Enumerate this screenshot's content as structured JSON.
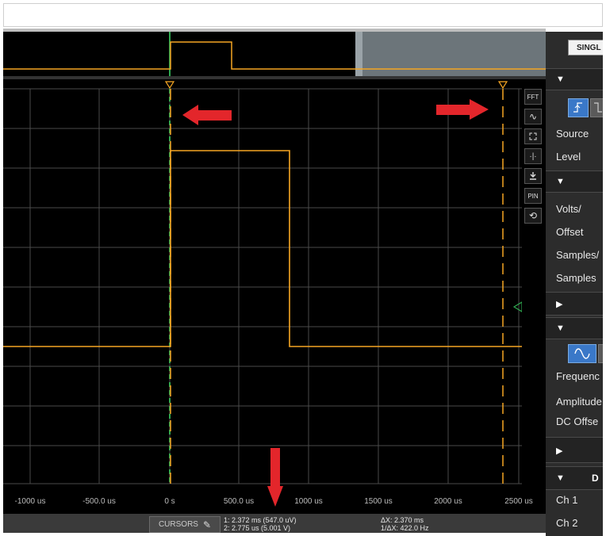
{
  "sidebar": {
    "single_button": "SINGL",
    "trigger_labels": [
      "Source",
      "Level"
    ],
    "channel_labels": [
      "Volts/",
      "Offset",
      "Samples/",
      "Samples"
    ],
    "wavegen_labels": [
      "Frequenc",
      "Amplitude",
      "DC Offse"
    ],
    "dc_section_title": "D",
    "dc_channels": [
      "Ch 1",
      "Ch 2"
    ]
  },
  "toolbar": {
    "fft_label": "FFT",
    "pin_label": "PIN"
  },
  "x_axis": {
    "ticks": [
      "-1000 us",
      "-500.0 us",
      "0 s",
      "500.0 us",
      "1000 us",
      "1500 us",
      "2000 us",
      "2500 us"
    ]
  },
  "statusbar": {
    "cursors_label": "CURSORS",
    "cursor1": "1: 2.372 ms (547.0 uV)",
    "cursor2": "2: 2.775 us (5.001 V)",
    "delta_x": "ΔX: 2.370 ms",
    "inv_delta_x": "1/ΔX: 422.0 Hz"
  },
  "colors": {
    "trace": "#f5a623",
    "trigger_line": "#2fa84f",
    "annotation_arrow": "#e3262b",
    "active_button": "#3a78c8"
  },
  "icons": {
    "tool_buttons": [
      "fft-icon",
      "filter-curve-icon",
      "fullscreen-icon",
      "cursor-split-icon",
      "download-icon",
      "pin-icon",
      "reset-icon"
    ]
  }
}
